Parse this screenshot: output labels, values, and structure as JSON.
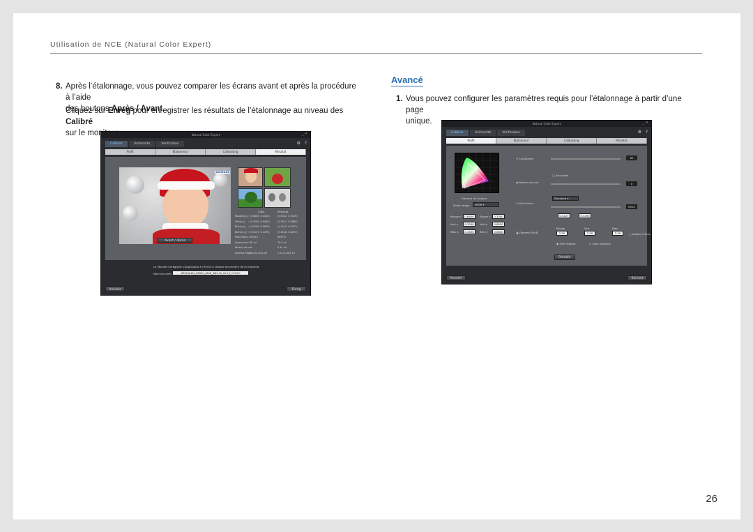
{
  "header": {
    "title": "Utilisation de NCE (Natural Color Expert)"
  },
  "step8": {
    "number": "8.",
    "line1_pre": "Après l’étalonnage, vous pouvez comparer les écrans avant et après la procédure à l’aide",
    "line2_pre": "des boutons ",
    "line2_bold": "Après / Avant",
    "line2_post": ".",
    "p2_pre": "Cliquez sur ",
    "p2_bold1": "Enreg",
    "p2_mid": " pour enregistrer les résultats de l’étalonnage au niveau des ",
    "p2_bold2": "Calibré",
    "p2_post": "sur le moniteur."
  },
  "section": {
    "title": "Avancé"
  },
  "step1": {
    "number": "1.",
    "line1": "Vous pouvez configurer les paramètres requis pour l’étalonnage à partir d’une page",
    "line2": "unique."
  },
  "page_number": "26",
  "app_left": {
    "title": "Natural Color Expert",
    "tabs": [
      "Calibrer",
      "Uniformité",
      "Vérification"
    ],
    "steps": [
      "Profil",
      "Étalonneur",
      "Calibrating",
      "Résultat"
    ],
    "toggle": {
      "avant": "Avant",
      "apres": "Après"
    },
    "brand": "SAMSUNG",
    "results_head": {
      "cible": "Cible",
      "resultat": "Résultat"
    },
    "results": [
      [
        "Rouge(x,y)",
        ": (0.6400, 0.3300)",
        "(0.6422, 0.3319)"
      ],
      [
        "Vert(x,y)",
        ": (0.3000, 0.6000)",
        "(0.3017, 0.5984)"
      ],
      [
        "Bleu(x,y)",
        ": (0.1500, 0.0600)",
        "(0.1513, 0.0577)"
      ],
      [
        "Blanc(x,y)",
        ": (0.3127, 0.3290)",
        "(0.3128, 0.3291)"
      ],
      [
        "Point blanc",
        ": 6504 K",
        "6497 K"
      ],
      [
        "Luminance",
        ": 80 cd",
        "79.5 cd"
      ],
      [
        "Niveau du noir",
        "",
        "0.41 cd"
      ],
      [
        "Gamma R/V/B",
        ": 2.20/2.20/2.20",
        "2.21/2.20/2.19"
      ]
    ],
    "message": "Le résultat enregistré s’appliquera à l’écran à chaque lancement de la machine.",
    "profile_label": "Nom du profil",
    "profile_value": "SMS24A450_D6500_sRGB_W80.00_G2.20_CCT.ICC",
    "cancel": "Annuler",
    "save": "Enreg"
  },
  "app_right": {
    "title": "Natural Color Expert",
    "tabs": [
      "Calibrer",
      "Uniformité",
      "Vérification"
    ],
    "steps": [
      "Profil",
      "Étalonneur",
      "Calibrating",
      "Résultat"
    ],
    "gamut_label": "Gamme de couleur",
    "mode_label": "Mode image",
    "mode_value": "sRGB",
    "luminance_label": "Luminance",
    "luminance_value": "80",
    "black_label": "Niveau du noir",
    "black_auto": "Actualiser",
    "black_value": "0",
    "white_label": "Point blanc",
    "white_preset": "Standard",
    "white_value": "6504",
    "white_x": "0.3127",
    "white_y": "0.3290",
    "gamma_label": "Gamme R/V/B",
    "gamma_cols": [
      "Rouge",
      "Vert",
      "Bleu"
    ],
    "gamma_vals": [
      "2.20",
      "2.20",
      "2.20"
    ],
    "apply_label": "Appliq. à tous",
    "prim_labels": [
      "Rouge x",
      "Rouge y",
      "Vert x",
      "Vert y",
      "Bleu x",
      "Bleu y"
    ],
    "prim_vals": [
      "0.6400",
      "0.3300",
      "0.3000",
      "0.6000",
      "0.1500",
      "0.0600"
    ],
    "radio1": "Fine linéaire",
    "radio2": "Total intensity",
    "reset": "Rétablir",
    "cancel": "Annuler",
    "next": "Suivant"
  },
  "colors": {
    "accent": "#2e6fb4",
    "app_bg": "#2a2c30",
    "panel": "#5c5f64",
    "tab_active": "#7cc6ff"
  }
}
